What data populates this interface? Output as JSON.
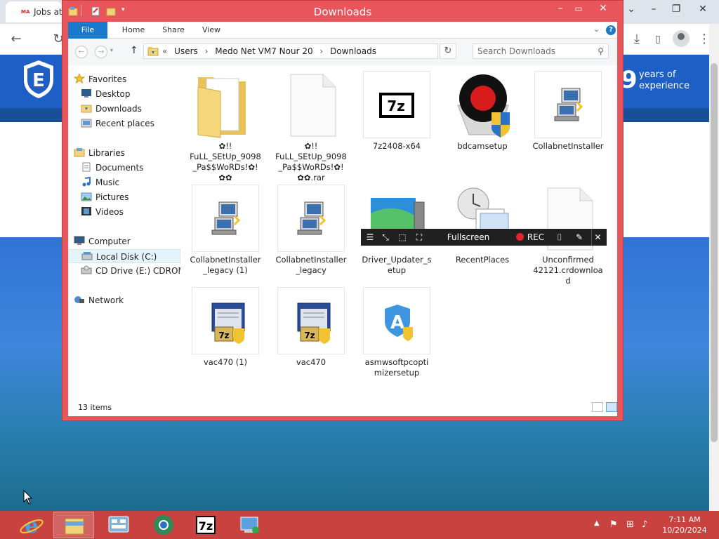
{
  "browser": {
    "tab_title": "Jobs at E",
    "favicon_text": "MA",
    "years": "9",
    "years_text_line1": "years of",
    "years_text_line2": "experience"
  },
  "explorer": {
    "title": "Downloads",
    "ribbon_tabs": [
      "File",
      "Home",
      "Share",
      "View"
    ],
    "address_crumbs": [
      "Users",
      "Medo Net VM7 Nour 20",
      "Downloads"
    ],
    "address_prefix": "«",
    "search_placeholder": "Search Downloads",
    "sidebar": [
      {
        "label": "Favorites",
        "icon": "star-icon",
        "group": true
      },
      {
        "label": "Desktop",
        "icon": "desktop-icon"
      },
      {
        "label": "Downloads",
        "icon": "downloads-folder-icon"
      },
      {
        "label": "Recent places",
        "icon": "recent-places-icon"
      },
      {
        "label": "Libraries",
        "icon": "libraries-icon",
        "group": true
      },
      {
        "label": "Documents",
        "icon": "documents-icon"
      },
      {
        "label": "Music",
        "icon": "music-icon"
      },
      {
        "label": "Pictures",
        "icon": "pictures-icon"
      },
      {
        "label": "Videos",
        "icon": "videos-icon"
      },
      {
        "label": "Computer",
        "icon": "computer-icon",
        "group": true
      },
      {
        "label": "Local Disk (C:)",
        "icon": "disk-icon",
        "selected": true
      },
      {
        "label": "CD Drive (E:) CDROM",
        "icon": "cd-drive-icon"
      },
      {
        "label": "Network",
        "icon": "network-icon",
        "group": true
      }
    ],
    "files": [
      {
        "name": "✿!! FuLL_SEtUp_9098 _Pa$$WoRDs!✿! ✿✿",
        "icon": "folder-icon"
      },
      {
        "name": "✿!! FuLL_SEtUp_9098 _Pa$$WoRDs!✿! ✿✿.rar",
        "icon": "blank-file-icon"
      },
      {
        "name": "7z2408-x64",
        "icon": "7zip-icon"
      },
      {
        "name": "bdcamsetup",
        "icon": "bdcam-icon"
      },
      {
        "name": "CollabnetInstaller",
        "icon": "installer-icon"
      },
      {
        "name": "CollabnetInstaller _legacy (1)",
        "icon": "installer-icon"
      },
      {
        "name": "CollabnetInstaller _legacy",
        "icon": "installer-icon"
      },
      {
        "name": "Driver_Updater_s etup",
        "icon": "driver-updater-icon"
      },
      {
        "name": "RecentPlaces",
        "icon": "recent-places-shortcut-icon"
      },
      {
        "name": "Unconfirmed 42121.crdownloa d",
        "icon": "blank-file-icon"
      },
      {
        "name": "vac470 (1)",
        "icon": "setup-box-icon"
      },
      {
        "name": "vac470",
        "icon": "setup-box-icon"
      },
      {
        "name": "asmwsoftpcopti mizersetup",
        "icon": "asmw-icon"
      }
    ],
    "status": "13 items"
  },
  "recorder": {
    "fullscreen_label": "Fullscreen",
    "rec_label": "REC"
  },
  "taskbar": {
    "time": "7:11 AM",
    "date": "10/20/2024",
    "apps": [
      "ie-icon",
      "file-explorer-icon",
      "server-manager-icon",
      "chrome-icon",
      "7zip-icon",
      "network-share-icon"
    ]
  },
  "colors": {
    "window_frame": "#e8555a",
    "taskbar": "#c8423f",
    "accent": "#1979ca"
  }
}
